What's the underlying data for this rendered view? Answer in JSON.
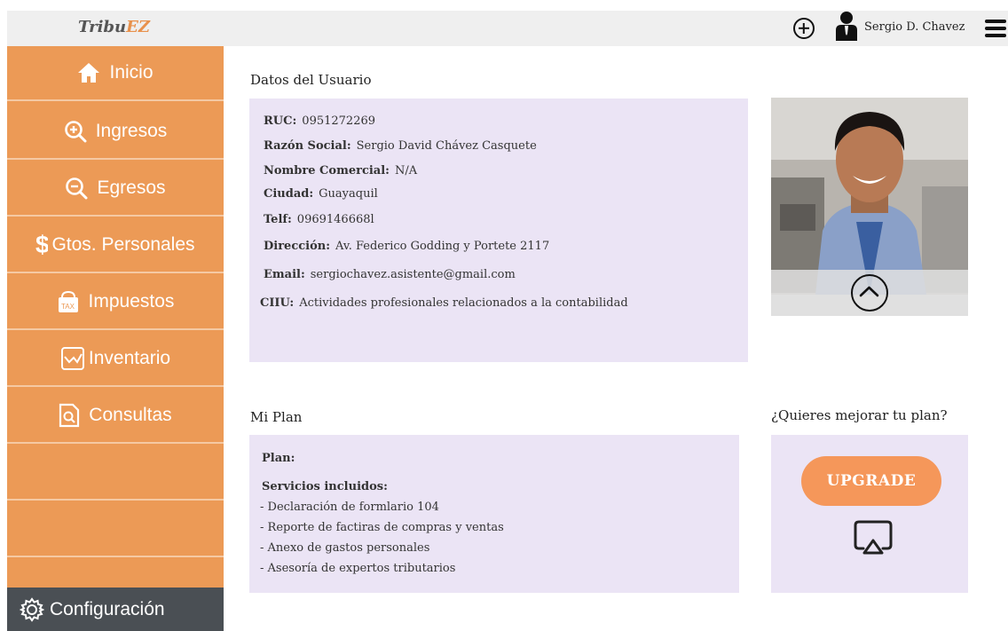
{
  "topbar": {
    "brand_part1": "Tribu",
    "brand_part2": "EZ",
    "user_name": "Sergio D. Chavez"
  },
  "sidebar": {
    "items": [
      {
        "label": "Inicio",
        "icon": "home-icon"
      },
      {
        "label": "Ingresos",
        "icon": "zoom-in-icon"
      },
      {
        "label": "Egresos",
        "icon": "zoom-out-icon"
      },
      {
        "label": "Gtos. Personales",
        "icon": "dollar-icon"
      },
      {
        "label": "Impuestos",
        "icon": "tax-icon"
      },
      {
        "label": "Inventario",
        "icon": "chart-icon"
      },
      {
        "label": "Consultas",
        "icon": "document-search-icon"
      }
    ],
    "config_label": "Configuración"
  },
  "user_data": {
    "title": "Datos del Usuario",
    "fields": [
      {
        "label": "RUC:",
        "value": "0951272269"
      },
      {
        "label": "Razón Social:",
        "value": "Sergio David Chávez Casquete"
      },
      {
        "label": "Nombre Comercial:",
        "value": "N/A"
      },
      {
        "label": "Ciudad:",
        "value": "Guayaquil"
      },
      {
        "label": "Telf:",
        "value": "0969146668l"
      },
      {
        "label": "Dirección:",
        "value": "Av. Federico Godding y Portete 2117"
      },
      {
        "label": "Email:",
        "value": "sergiochavez.asistente@gmail.com"
      },
      {
        "label": "CIIU:",
        "value": "Actividades profesionales relacionados a la contabilidad"
      }
    ]
  },
  "plan": {
    "title": "Mi Plan",
    "plan_label": "Plan:",
    "services_label": "Servicios incluidos:",
    "services": [
      "- Declaración de formlario 104",
      "- Reporte de factiras de compras y ventas",
      "- Anexo de gastos personales",
      "- Asesoría de expertos tributarios"
    ]
  },
  "upgrade": {
    "title": "¿Quieres mejorar tu plan?",
    "button_label": "UPGRADE"
  },
  "colors": {
    "sidebar": "#ec9a56",
    "card": "#ebe4f5",
    "config": "#4a4f54",
    "upgrade_button": "#f5975a"
  }
}
